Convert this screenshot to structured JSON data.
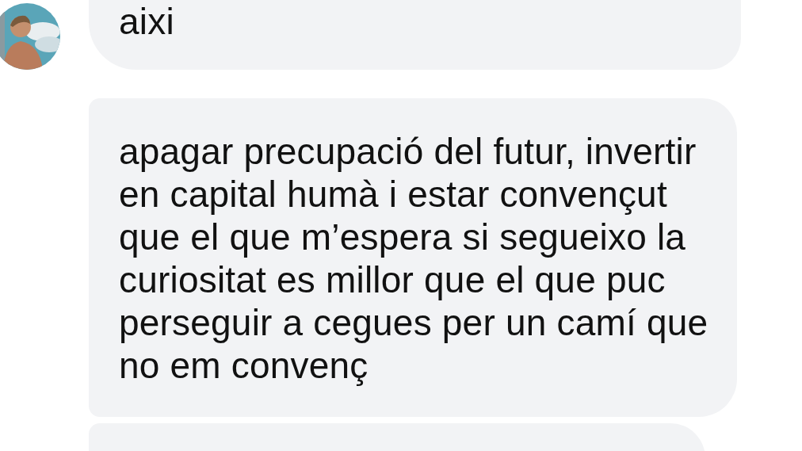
{
  "messages": [
    {
      "kind": "text",
      "avatar": true,
      "lines": [
        "aixi"
      ]
    },
    {
      "kind": "text",
      "avatar": false,
      "lines": [
        "apagar precupació del futur, invertir",
        "en capital humà i estar convençut",
        "que el que m’espera si segueixo la",
        "curiositat es millor que el que puc",
        "perseguir a cegues per un camí que",
        "no em convenç"
      ]
    },
    {
      "kind": "partial",
      "avatar": false
    }
  ]
}
